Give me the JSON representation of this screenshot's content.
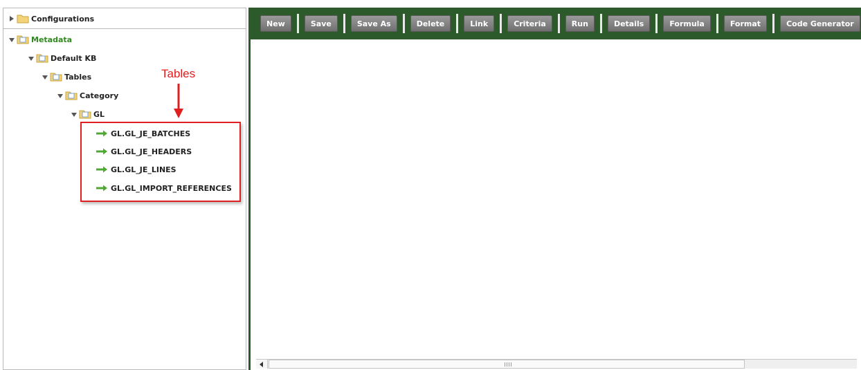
{
  "tree": {
    "configurations": "Configurations",
    "metadata": "Metadata",
    "default_kb": "Default KB",
    "tables": "Tables",
    "category": "Category",
    "gl": "GL",
    "items": [
      "GL.GL_JE_BATCHES",
      "GL.GL_JE_HEADERS",
      "GL.GL_JE_LINES",
      "GL.GL_IMPORT_REFERENCES"
    ]
  },
  "annotation": {
    "label": "Tables",
    "color": "#e31b1b"
  },
  "toolbar": {
    "buttons": [
      "New",
      "Save",
      "Save As",
      "Delete",
      "Link",
      "Criteria",
      "Run",
      "Details",
      "Formula",
      "Format",
      "Code Generator"
    ]
  },
  "colors": {
    "toolbar_bg": "#2d5a2a",
    "tree_green": "#2f8a1e",
    "arrow_green": "#4fa832"
  }
}
